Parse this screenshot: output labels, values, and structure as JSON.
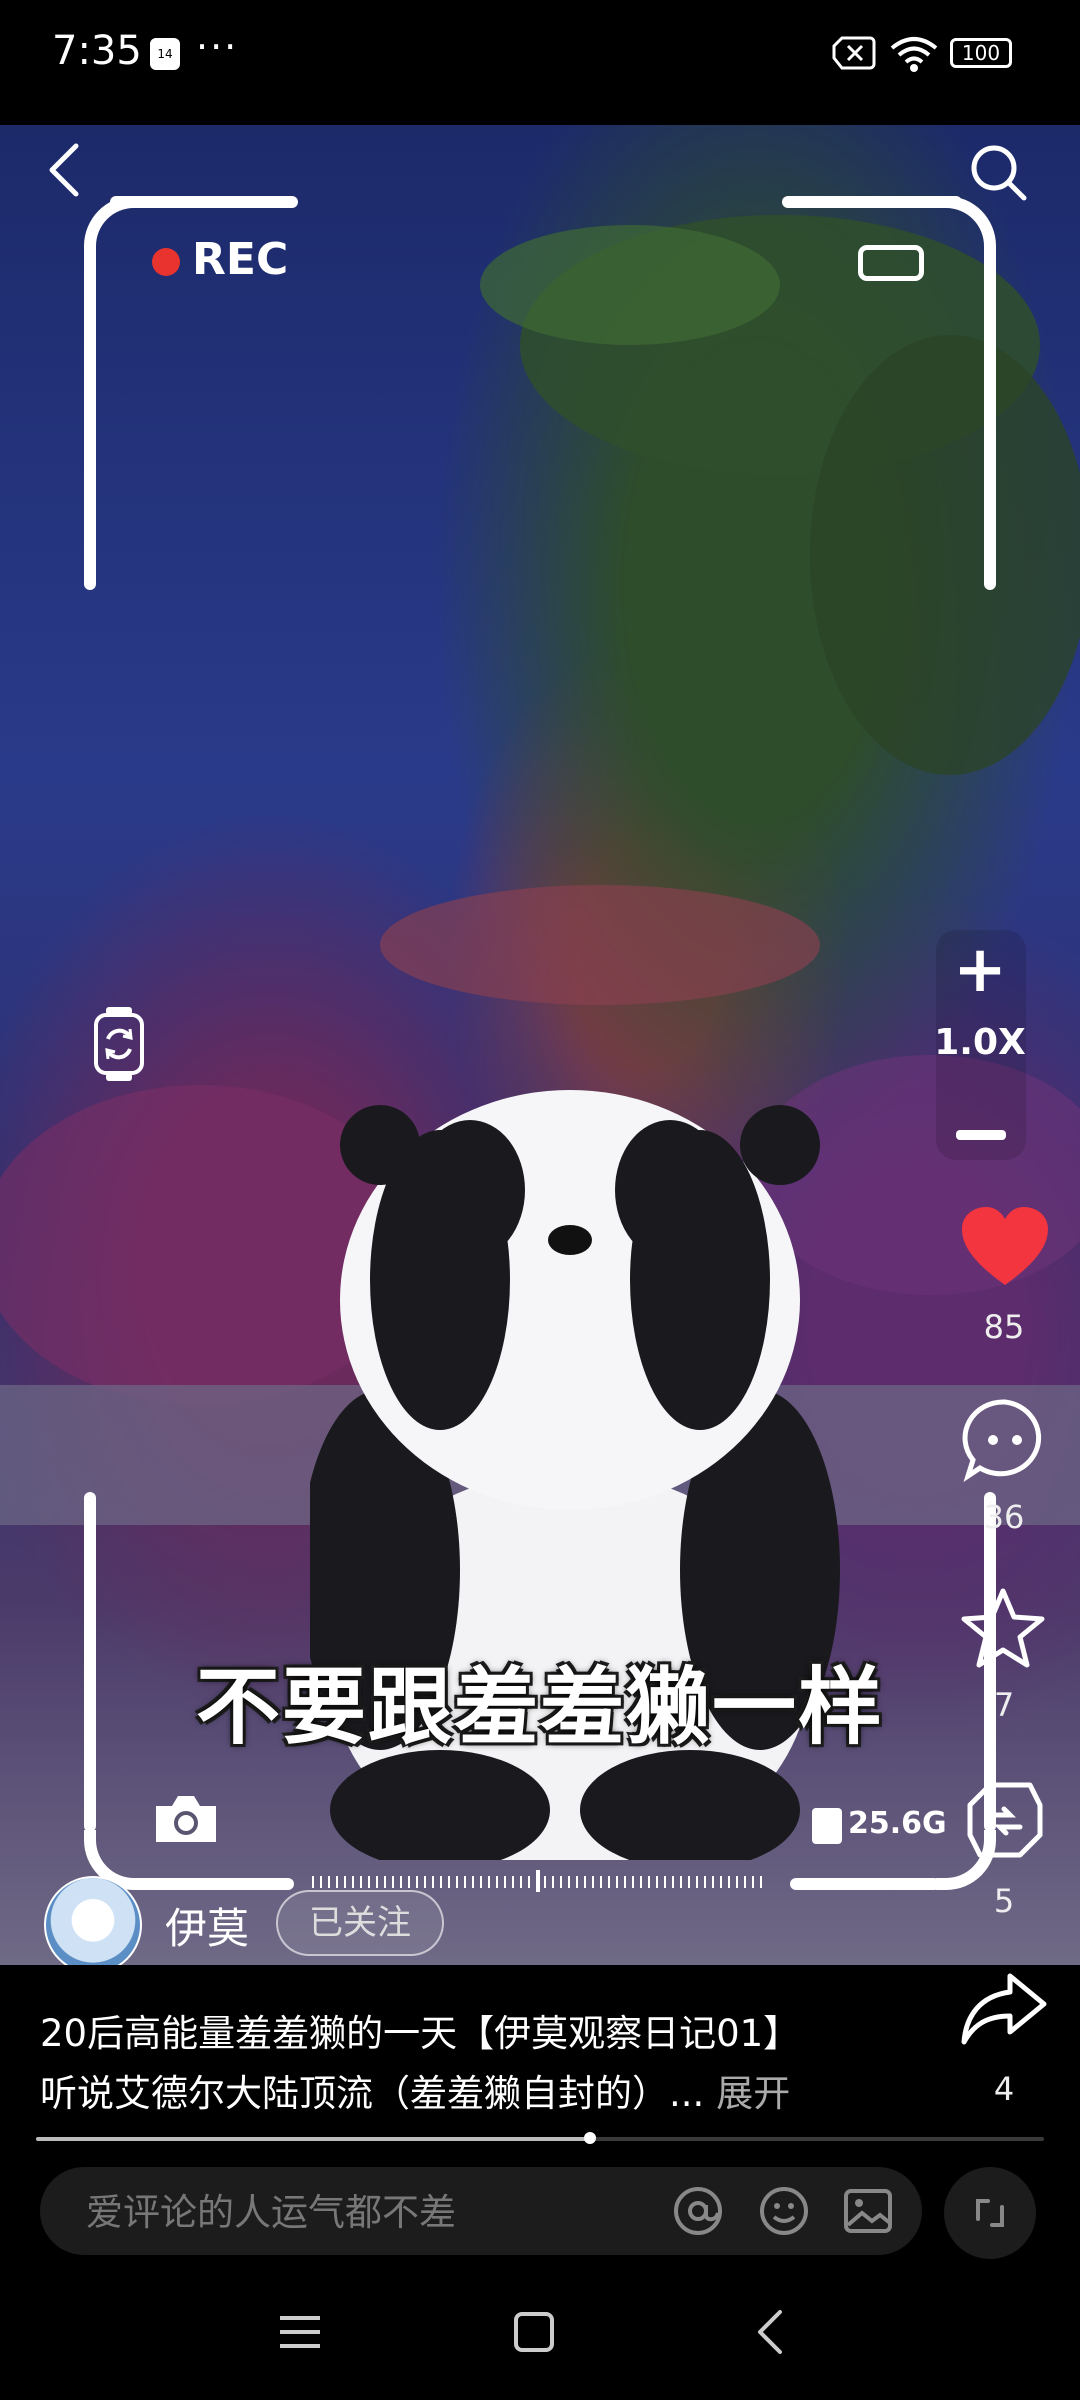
{
  "status_bar": {
    "time": "7:35",
    "calendar_day": "14",
    "more": "···",
    "battery": "100"
  },
  "video": {
    "rec_label": "REC",
    "zoom_level": "1.0X",
    "subtitle": "不要跟羞羞獭一样",
    "storage": "25.6G"
  },
  "actions": {
    "likes": "85",
    "comments": "36",
    "favorites": "7",
    "reposts": "5",
    "shares": "4",
    "like_color": "#f2353f"
  },
  "author": {
    "name": "伊莫",
    "follow_label": "已关注"
  },
  "post": {
    "title": "20后高能量羞羞獭的一天【伊莫观察日记01】",
    "description": "听说艾德尔大陆顶流（羞羞獭自封的）...",
    "expand_label": "展开"
  },
  "progress": {
    "fraction": 0.55
  },
  "comment": {
    "placeholder": "爱评论的人运气都不差"
  }
}
